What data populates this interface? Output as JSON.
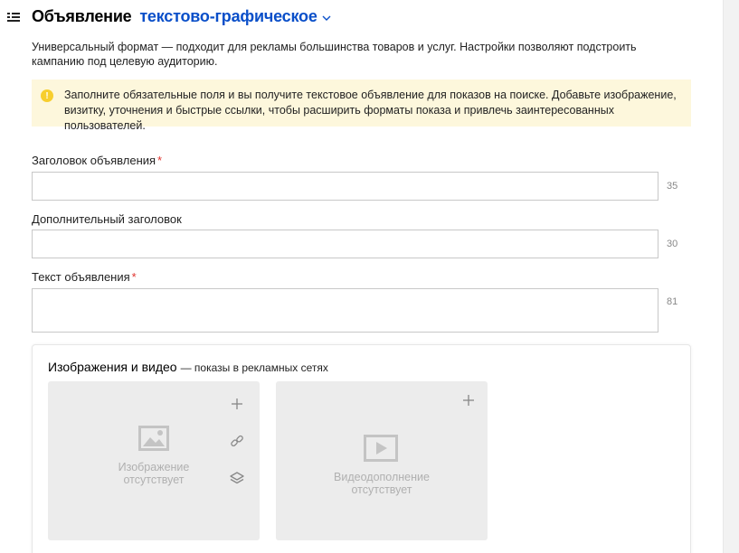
{
  "header": {
    "title_prefix": "Объявление",
    "title_type": "текстово-графическое"
  },
  "description": "Универсальный формат — подходит для рекламы большинства товаров и услуг. Настройки позволяют подстроить кампанию под целевую аудиторию.",
  "notice": {
    "icon": "!",
    "text": "Заполните обязательные поля и вы получите текстовое объявление для показов на поиске. Добавьте изображение, визитку, уточнения и быстрые ссылки, чтобы расширить форматы показа и привлечь заинтересованных пользователей."
  },
  "fields": {
    "headline": {
      "label": "Заголовок объявления",
      "required_mark": "*",
      "value": "",
      "counter": "35"
    },
    "subheadline": {
      "label": "Дополнительный заголовок",
      "value": "",
      "counter": "30"
    },
    "text": {
      "label": "Текст объявления",
      "required_mark": "*",
      "value": "",
      "counter": "81"
    }
  },
  "media": {
    "title": "Изображения и видео",
    "subtitle": "— показы в рекламных сетях",
    "image_slot": {
      "empty_text_line1": "Изображение",
      "empty_text_line2": "отсутствует"
    },
    "video_slot": {
      "empty_text_line1": "Видеодополнение",
      "empty_text_line2": "отсутствует"
    }
  },
  "colors": {
    "accent_blue": "#0a4fc9",
    "notice_bg": "#fdf7dc",
    "notice_icon": "#f7ce2e",
    "required": "#e0332e"
  }
}
